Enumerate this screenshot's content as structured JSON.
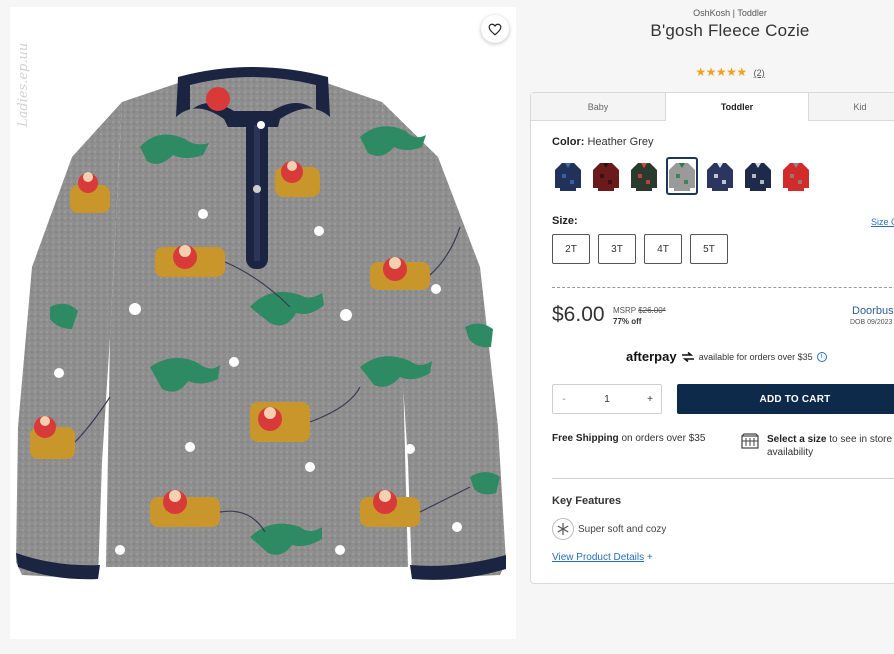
{
  "watermark": "Ladies.ep.uu",
  "product": {
    "brand": "OshKosh | Toddler",
    "title": "B'gosh Fleece Cozie",
    "stars": "★★★★★",
    "review_count": "(2)",
    "image_icon": "heart-icon"
  },
  "tabs": [
    {
      "label": "Baby",
      "active": false
    },
    {
      "label": "Toddler",
      "active": true
    },
    {
      "label": "Kid",
      "active": false
    }
  ],
  "color": {
    "label": "Color:",
    "value": "Heather Grey",
    "swatches": [
      {
        "name": "navy-print",
        "main": "#22315a",
        "accent": "#3a6fb0"
      },
      {
        "name": "red-plaid",
        "main": "#6b1a1a",
        "accent": "#2a1212"
      },
      {
        "name": "dark-print",
        "main": "#2b3a2e",
        "accent": "#d84a3a"
      },
      {
        "name": "heather-grey",
        "main": "#9a9a9a",
        "accent": "#2e7a4a"
      },
      {
        "name": "navy-buffalo-check",
        "main": "#2a3560",
        "accent": "#e8e8ee"
      },
      {
        "name": "grey-navy-colorblock",
        "main": "#1e2a4a",
        "accent": "#d9d9d9"
      },
      {
        "name": "red-grey-colorblock",
        "main": "#d12b2b",
        "accent": "#8a8a8a"
      }
    ],
    "selected_index": 3
  },
  "size": {
    "label": "Size:",
    "chart_link": "Size Chart",
    "options": [
      "2T",
      "3T",
      "4T",
      "5T"
    ]
  },
  "price": {
    "current": "$6.00",
    "msrp_label": "MSRP",
    "msrp_value": "$26.00*",
    "percent_off": "77% off",
    "doorbuster": "Doorbuster",
    "dob": "DOB 09/2023"
  },
  "afterpay": {
    "logo": "afterpay",
    "text": "available for orders over $35"
  },
  "quantity": {
    "minus": "-",
    "value": "1",
    "plus": "+"
  },
  "add_to_cart": "ADD TO CART",
  "shipping": {
    "bold": "Free Shipping",
    "rest": " on orders over $35"
  },
  "store": {
    "bold": "Select a size",
    "rest": " to see in store availability"
  },
  "key_features": {
    "title": "Key Features",
    "items": [
      "Super soft and cozy"
    ],
    "details_link": "View Product Details",
    "details_plus": "+"
  },
  "colors": {
    "accent_navy": "#0d2a4a",
    "link_blue": "#2a6fb5",
    "star_gold": "#f0a11d",
    "fleece_grey": "#8f8f8f",
    "trim_navy": "#1b2440"
  }
}
